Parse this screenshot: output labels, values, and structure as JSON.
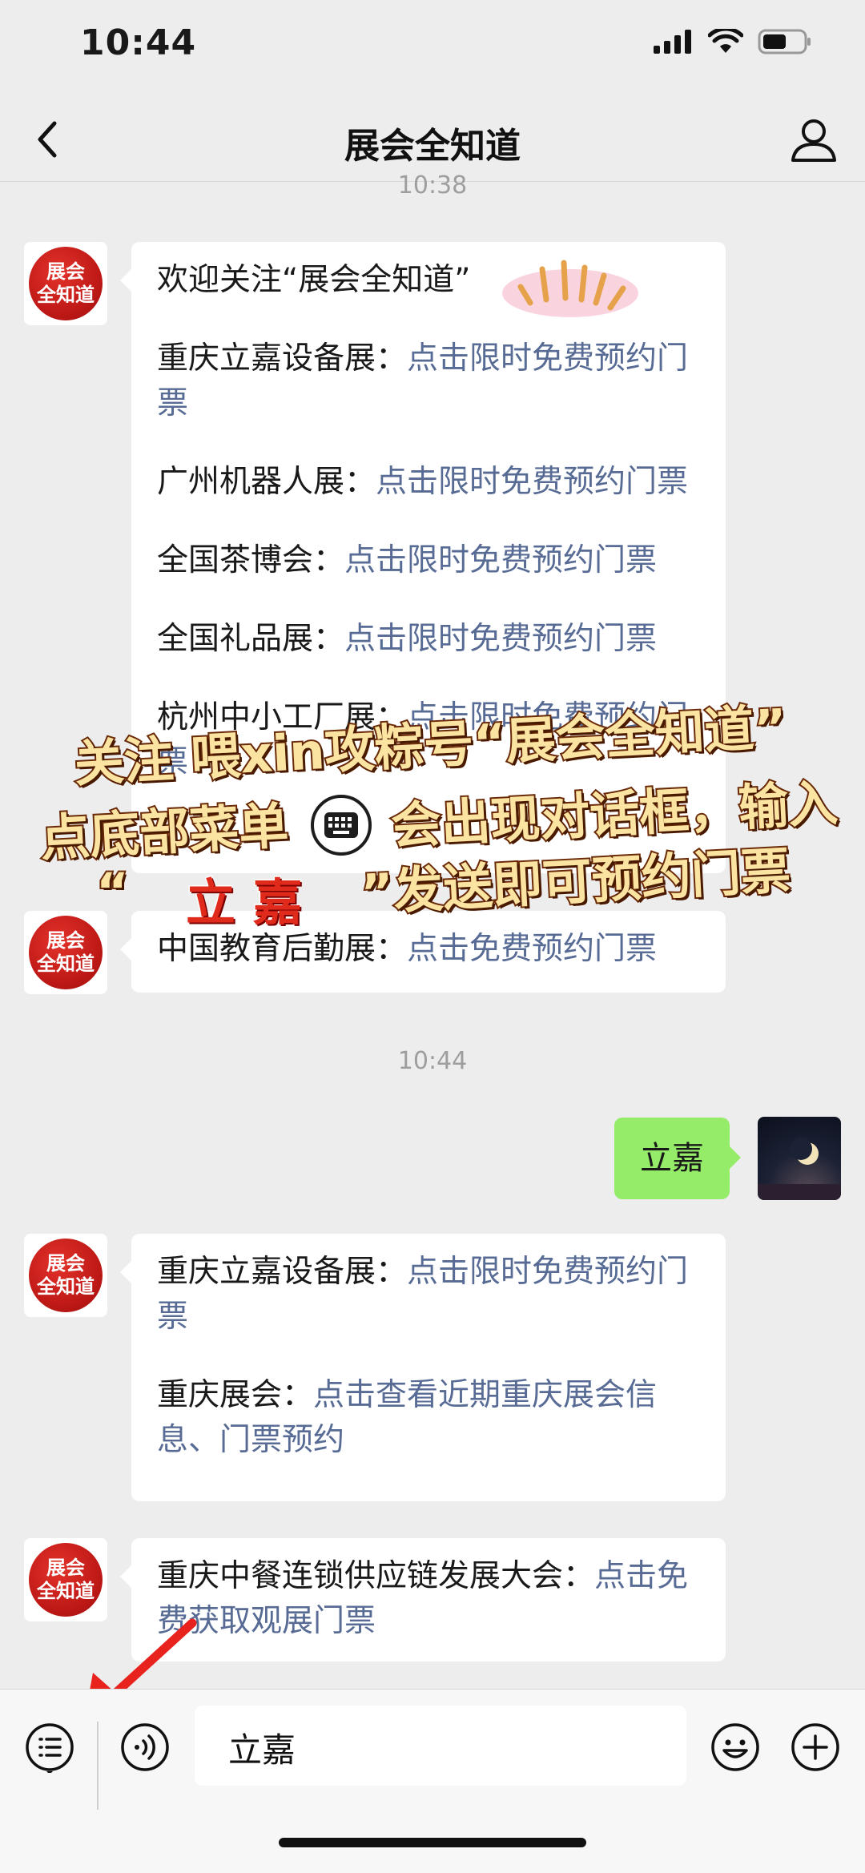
{
  "status_bar": {
    "time": "10:44"
  },
  "nav": {
    "title": "展会全知道"
  },
  "timestamps": [
    "10:38",
    "10:44"
  ],
  "bot": {
    "avatar_text_line1": "展会",
    "avatar_text_line2": "全知道"
  },
  "messages": {
    "welcome": {
      "intro": "欢迎关注“展会全知道”",
      "items": [
        {
          "name": "重庆立嘉设备展：",
          "link": "点击限时免费预约门票"
        },
        {
          "name": "广州机器人展：",
          "link": "点击限时免费预约门票"
        },
        {
          "name": "全国茶博会：",
          "link": "点击限时免费预约门票"
        },
        {
          "name": "全国礼品展：",
          "link": "点击限时免费预约门票"
        },
        {
          "name": "杭州中小工厂展：",
          "link": "点击限时免费预约门票"
        }
      ]
    },
    "edu": {
      "name": "中国教育后勤展：",
      "link": "点击免费预约门票"
    },
    "user": {
      "text": "立嘉"
    },
    "reply1": {
      "items": [
        {
          "name": "重庆立嘉设备展：",
          "link": "点击限时免费预约门票"
        },
        {
          "name": "重庆展会：",
          "link": "点击查看近期重庆展会信息、门票预约"
        }
      ]
    },
    "reply2": {
      "name": "重庆中餐连锁供应链发展大会：",
      "link": "点击免费获取观展门票"
    }
  },
  "overlay": {
    "line1": "关注 喂xin攻粽号“展会全知道”",
    "line2a": "点底部菜单",
    "line2b": "会出现对话框，输入",
    "line3a": "“",
    "line3_keyword": "立 嘉",
    "line3b": "”发送即可预约门票"
  },
  "input": {
    "value": "立嘉"
  },
  "colors": {
    "link": "#576b95",
    "user_bubble": "#95ec69",
    "logo_red": "#c01a17",
    "arrow_red": "#e8221c"
  }
}
